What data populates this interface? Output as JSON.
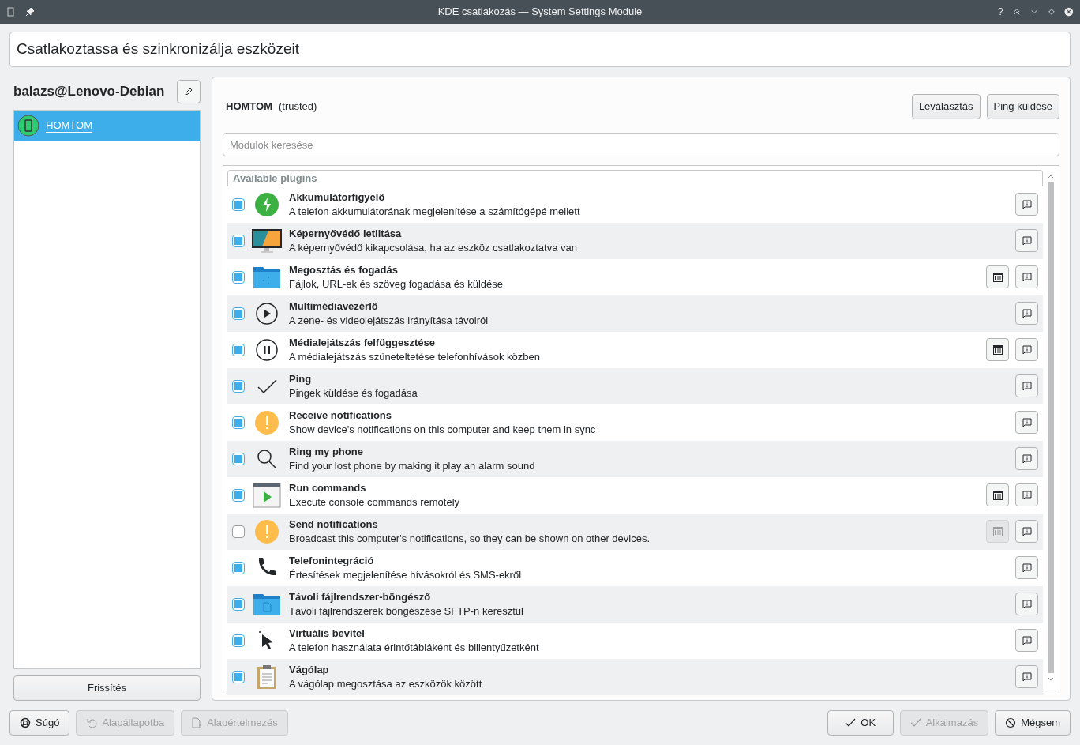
{
  "window": {
    "title": "KDE csatlakozás — System Settings Module",
    "help_button": "?"
  },
  "header": {
    "title": "Csatlakoztassa és szinkronizálja eszközeit"
  },
  "sidebar": {
    "host": "balazs@Lenovo-Debian",
    "devices": [
      {
        "name": "HOMTOM",
        "selected": true
      }
    ],
    "refresh_button": "Frissítés"
  },
  "device": {
    "name": "HOMTOM",
    "status": "(trusted)",
    "buttons": [
      {
        "label": "Leválasztás"
      },
      {
        "label": "Ping küldése"
      }
    ]
  },
  "search": {
    "placeholder": "Modulok keresése"
  },
  "plugins": {
    "heading": "Available plugins",
    "items": [
      {
        "kind": "battery",
        "title": "Akkumulátorfigyelő",
        "description": "A telefon akkumulátorának megjelenítése a számítógépé mellett",
        "checked": true
      },
      {
        "kind": "screen",
        "title": "Képernyővédő letiltása",
        "description": "A képernyővédő kikapcsolása, ha az eszköz csatlakoztatva van",
        "checked": true
      },
      {
        "kind": "share",
        "title": "Megosztás és fogadás",
        "description": "Fájlok, URL-ek és szöveg fogadása és küldése",
        "checked": true,
        "settings_enabled": true
      },
      {
        "kind": "play",
        "title": "Multimédiavezérlő",
        "description": "A zene- és videolejátszás irányítása távolról",
        "checked": true
      },
      {
        "kind": "pause",
        "title": "Médialejátszás felfüggesztése",
        "description": "A médialejátszás szüneteltetése telefonhívások közben",
        "checked": true,
        "settings_enabled": true
      },
      {
        "kind": "check",
        "title": "Ping",
        "description": "Pingek küldése és fogadása",
        "checked": true
      },
      {
        "kind": "warning",
        "title": "Receive notifications",
        "description": "Show device's notifications on this computer and keep them in sync",
        "checked": true
      },
      {
        "kind": "search",
        "title": "Ring my phone",
        "description": "Find your lost phone by making it play an alarm sound",
        "checked": true
      },
      {
        "kind": "terminal",
        "title": "Run commands",
        "description": "Execute console commands remotely",
        "checked": true,
        "settings_enabled": true
      },
      {
        "kind": "warning",
        "title": "Send notifications",
        "description": "Broadcast this computer's notifications, so they can be shown on other devices.",
        "checked": false,
        "settings_enabled": false
      },
      {
        "kind": "phone",
        "title": "Telefonintegráció",
        "description": "Értesítések megjelenítése hívásokról és SMS-ekről",
        "checked": true
      },
      {
        "kind": "folder",
        "title": "Távoli fájlrendszer-böngésző",
        "description": "Távoli fájlrendszerek böngészése SFTP-n keresztül",
        "checked": true
      },
      {
        "kind": "pointer",
        "title": "Virtuális bevitel",
        "description": "A telefon használata érintőtábláként és billentyűzetként",
        "checked": true
      },
      {
        "kind": "clipboard",
        "title": "Vágólap",
        "description": "A vágólap megosztása az eszközök között",
        "checked": true
      }
    ]
  },
  "footer": {
    "left": [
      {
        "kind": "help",
        "label": "Súgó",
        "disabled": false
      },
      {
        "kind": "reset",
        "label": "Alapállapotba",
        "disabled": true
      },
      {
        "kind": "defaults",
        "label": "Alapértelmezés",
        "disabled": true
      }
    ],
    "right": [
      {
        "kind": "ok",
        "label": "OK",
        "disabled": false
      },
      {
        "kind": "ok",
        "label": "Alkalmazás",
        "disabled": true
      },
      {
        "kind": "cancel",
        "label": "Mégsem",
        "disabled": false
      }
    ]
  }
}
